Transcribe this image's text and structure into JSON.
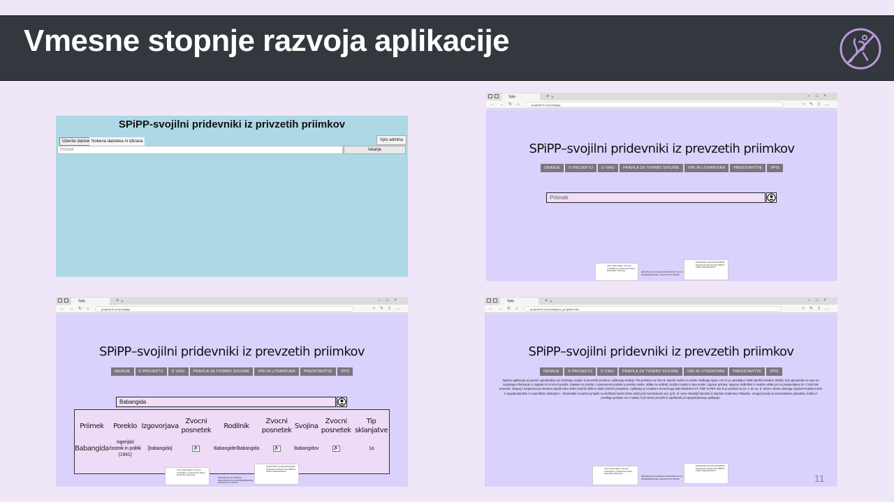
{
  "slide": {
    "title": "Vmesne stopnje razvoja aplikacije",
    "page_number": "11"
  },
  "screen1": {
    "title": "SPiPP-svojilni pridevniki iz privzetih priimkov",
    "file_button": "Izberite datoteko",
    "file_status": "Nobena datoteka ni izbrana",
    "admin_button": "Vpis admina",
    "search_placeholder": "Priimek",
    "search_button": "Iskanje"
  },
  "browser": {
    "tab_label": "Spip",
    "url": "projects.ff.uni-lj.si/spipp",
    "url_projekt": "projects.ff.uni-lj.si/spipp/o_projektu.html"
  },
  "app": {
    "title": "SPiPP–svojilni pridevniki iz prevzetih priimkov",
    "nav": [
      "ISKANJE",
      "O PROJEKTU",
      "O VIRU",
      "PRAVILA ZA TVORBO SVOJINE",
      "VIRI IN LITERATURA",
      "PREDSTAVITVE",
      "VPIS"
    ],
    "search_placeholder": "Priimek",
    "logo1_text": "Javni štipendijski, razvojni, invalidski in preživninski sklad Republike Slovenije",
    "logo2_text": "REPUBLIKA SLOVENIJA MINISTRSTVO ZA IZOBRAŽEVANJE, ZNANOST IN ŠPORT",
    "logo3_text": "EVROPSKA UNIJA EVROPSKI SOCIALNI SKLAD NALOŽBA V VAŠO PRIHODNOST"
  },
  "screen3": {
    "search_value": "Babangida",
    "headers": [
      "Priimek",
      "Poreklo",
      "Izgovorjava",
      "Zvocni posnetek",
      "Rodilnik",
      "Zvocni posnetek",
      "Svojina",
      "Zvocni posnetek",
      "Tip sklanjatve"
    ],
    "row": {
      "priimek": "Babangida",
      "poreklo": "nigerijski častnik in politik (1941)",
      "izgovorjava": "[babangida]",
      "rodilnik": "Babangide/Babangida",
      "svojina": "Babangidov",
      "tip": "1a"
    }
  },
  "screen4": {
    "paragraph": "Spletna aplikacija za pomoč uporabnikom pri izražanju svojine iz prevzetih priimkov. Aplikacija vsebuje 750 priimkov na črko B, katerih nosilci so osebe moškega spola. Kot vir je uporabljen Veliki splošni leksikon (2006). Kot uporabniku so vam na razpolago informacije o zapisani in izrečeni podobi. Zapisani so priimki z opisovanimi podatki o poreklu osebe, oblike za rodilnik, izraženi svojini in tipu tvorbe. Izgovor priimka, njegovo rodilniško in svojilno obliko po so pregremljene še z zvočnimi posnetki. Skupaj z dvojnicami je trenutno zajetih blizu 2500 zvočnih oblik in 2500 zvočnih posnetkov. Aplikacija je rezultat 4-mesečnega dela študentov FF, FMF in PEF UM, ki je potekal od 15. 2. do 14. 6. 2019 v okviru Javnega razpisa Projektno delo z negospodarskim in neprofitnim sektorjem – Študentski inovativni projekti za družbeno korist 2016–2020 pod mentorstvom red. prof. dr. Irene Stramljič Breznik in Darinke Koderman Paladine. Vsegrelj kuala za konstruktivne pripombe, kritike in predloge poslane na e-naslov, ki jih bomo preučili in upoštevali pri izpopolnjevanju aplikacije."
  }
}
